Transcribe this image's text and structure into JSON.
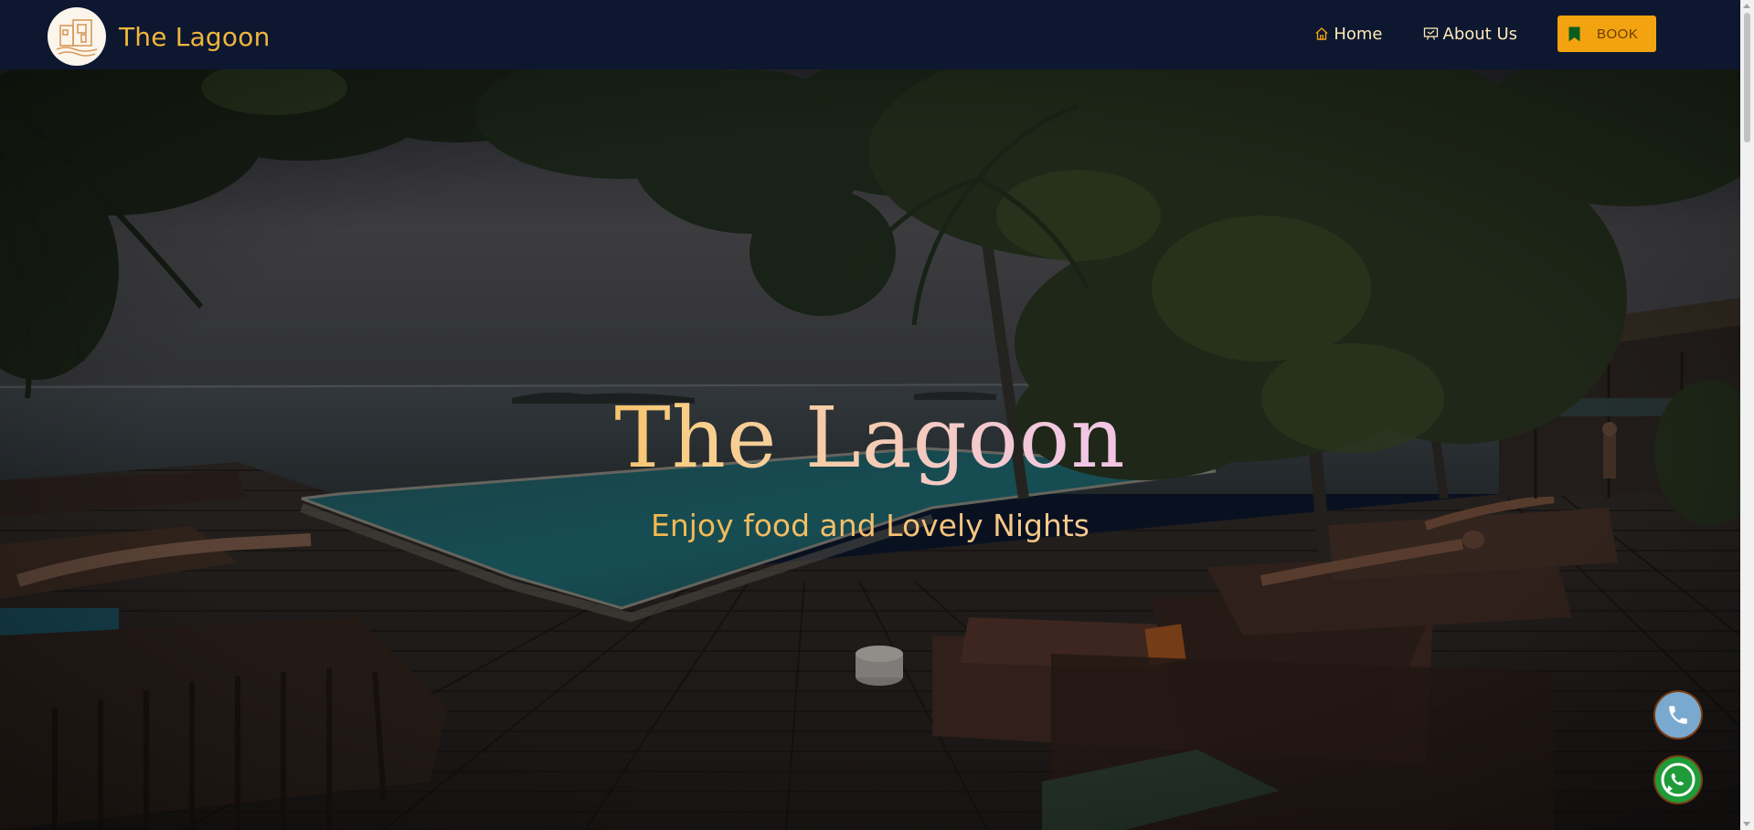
{
  "brand": {
    "name": "The Lagoon",
    "logo_icon": "hotel-building-logo"
  },
  "nav": {
    "home_label": "Home",
    "home_icon": "house-icon",
    "about_label": "About Us",
    "about_icon": "presentation-icon",
    "book_label": "BOOK",
    "book_icon": "bookmark-icon"
  },
  "hero": {
    "title": "The Lagoon",
    "subtitle": "Enjoy food and Lovely Nights",
    "background": "resort infinity pool with sea view, palm trees and sun loungers"
  },
  "floating": {
    "phone_icon": "phone-icon",
    "whatsapp_icon": "whatsapp-icon"
  },
  "colors": {
    "navbar_bg": "#0d1730",
    "brand_gold": "#f0b63c",
    "book_button": "#f3a30f",
    "phone_button": "#7aa9cf",
    "whatsapp_button": "#1f9b3a"
  }
}
